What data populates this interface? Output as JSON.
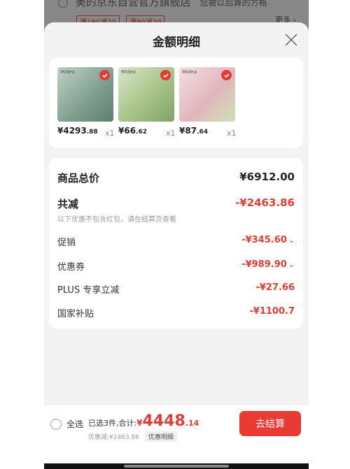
{
  "background": {
    "store_name": "美的京东自营官方旗舰店",
    "right_text": "您被以后算的方格",
    "tags": [
      "满180减20",
      "满99减20"
    ],
    "more": "更多 ›"
  },
  "sheet": {
    "title": "金额明细",
    "close_icon": "close-icon"
  },
  "products": [
    {
      "brand": "Midea",
      "price_int": "¥4293",
      "price_dec": ".88",
      "qty": "x1",
      "color": "#8aa99a"
    },
    {
      "brand": "Midea",
      "price_int": "¥66",
      "price_dec": ".62",
      "qty": "x1",
      "color": "#b9cf9d"
    },
    {
      "brand": "Midea",
      "price_int": "¥87",
      "price_dec": ".64",
      "qty": "x1",
      "color": "#e7c2c6"
    }
  ],
  "summary": {
    "total_label": "商品总价",
    "total_value": "¥6912.00",
    "reduce_label": "共减",
    "reduce_value": "-¥2463.86",
    "reduce_note": "以下优惠不包含红包，请在结算页查看",
    "promo_label": "促销",
    "promo_value": "-¥345.60",
    "coupon_label": "优惠券",
    "coupon_value": "-¥989.90",
    "plus_label": "PLUS 专享立减",
    "plus_value": "-¥27.66",
    "subsidy_label": "国家补贴",
    "subsidy_value": "-¥1100.7"
  },
  "bottom": {
    "select_all": "全选",
    "selected_text": "已选3件,合计:",
    "currency": "¥",
    "amount_int": "4448",
    "amount_dec": ".14",
    "discount_text": "优惠减:¥2463.86",
    "detail_button": "优惠明细",
    "checkout": "去结算"
  },
  "colors": {
    "accent": "#e23c35",
    "checkout": "#ea3b33",
    "sheet_bg": "#f3f3f3"
  }
}
